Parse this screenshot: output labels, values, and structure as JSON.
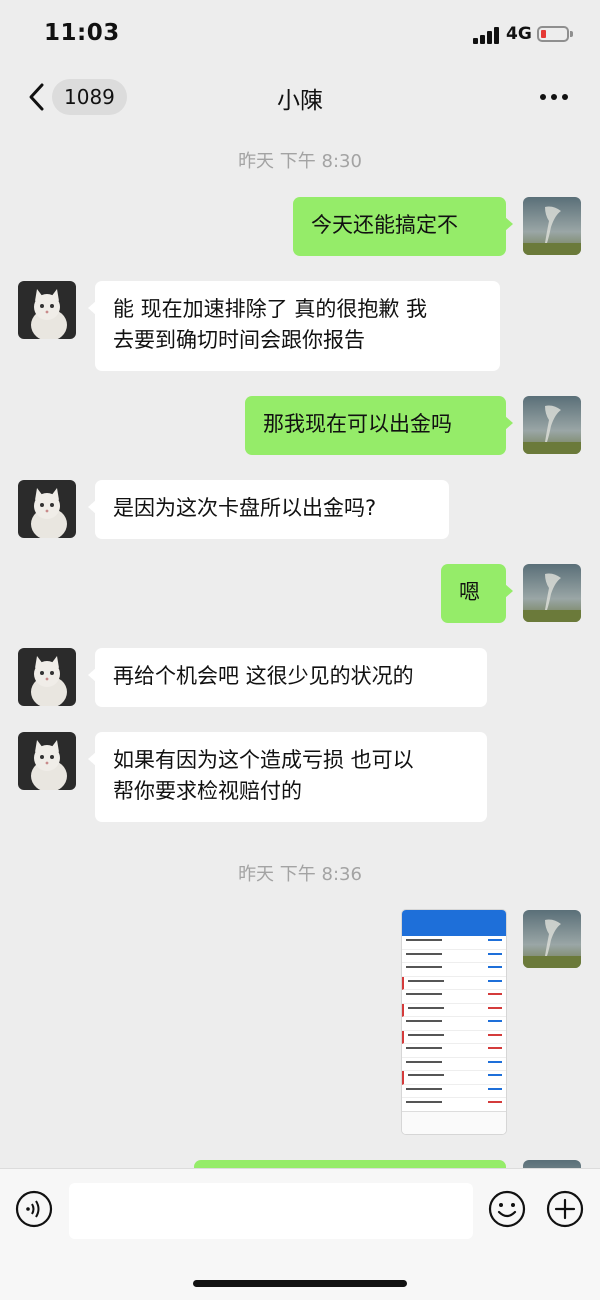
{
  "status_bar": {
    "time": "11:03",
    "network": "4G",
    "battery_level": 0.15,
    "battery_color": "#e53935"
  },
  "header": {
    "back_badge": "1089",
    "title": "小陳",
    "more_icon": "more-horizontal-icon"
  },
  "timestamps": [
    "昨天 下午 8:30",
    "昨天 下午 8:36"
  ],
  "messages": [
    {
      "side": "sent",
      "text": "今天还能搞定不"
    },
    {
      "side": "received",
      "text_lines": [
        "能 现在加速排除了 真的很抱歉 我",
        "去要到确切时间会跟你报告"
      ]
    },
    {
      "side": "sent",
      "text": "那我现在可以出金吗"
    },
    {
      "side": "received",
      "text": "是因为这次卡盘所以出金吗?"
    },
    {
      "side": "sent",
      "text": "嗯"
    },
    {
      "side": "received",
      "text": "再给个机会吧 这很少见的状况的"
    },
    {
      "side": "received",
      "text_lines": [
        "如果有因为这个造成亏损 也可以",
        "帮你要求检视赔付的"
      ]
    },
    {
      "side": "sent",
      "type": "image",
      "description_icon": "trading-screenshot-thumbnail"
    }
  ],
  "colors": {
    "sent_bubble": "#95ec69",
    "received_bubble": "#ffffff",
    "background": "#ededed"
  },
  "input_bar": {
    "value": "",
    "icons": [
      "voice-icon",
      "emoji-icon",
      "plus-icon"
    ]
  }
}
